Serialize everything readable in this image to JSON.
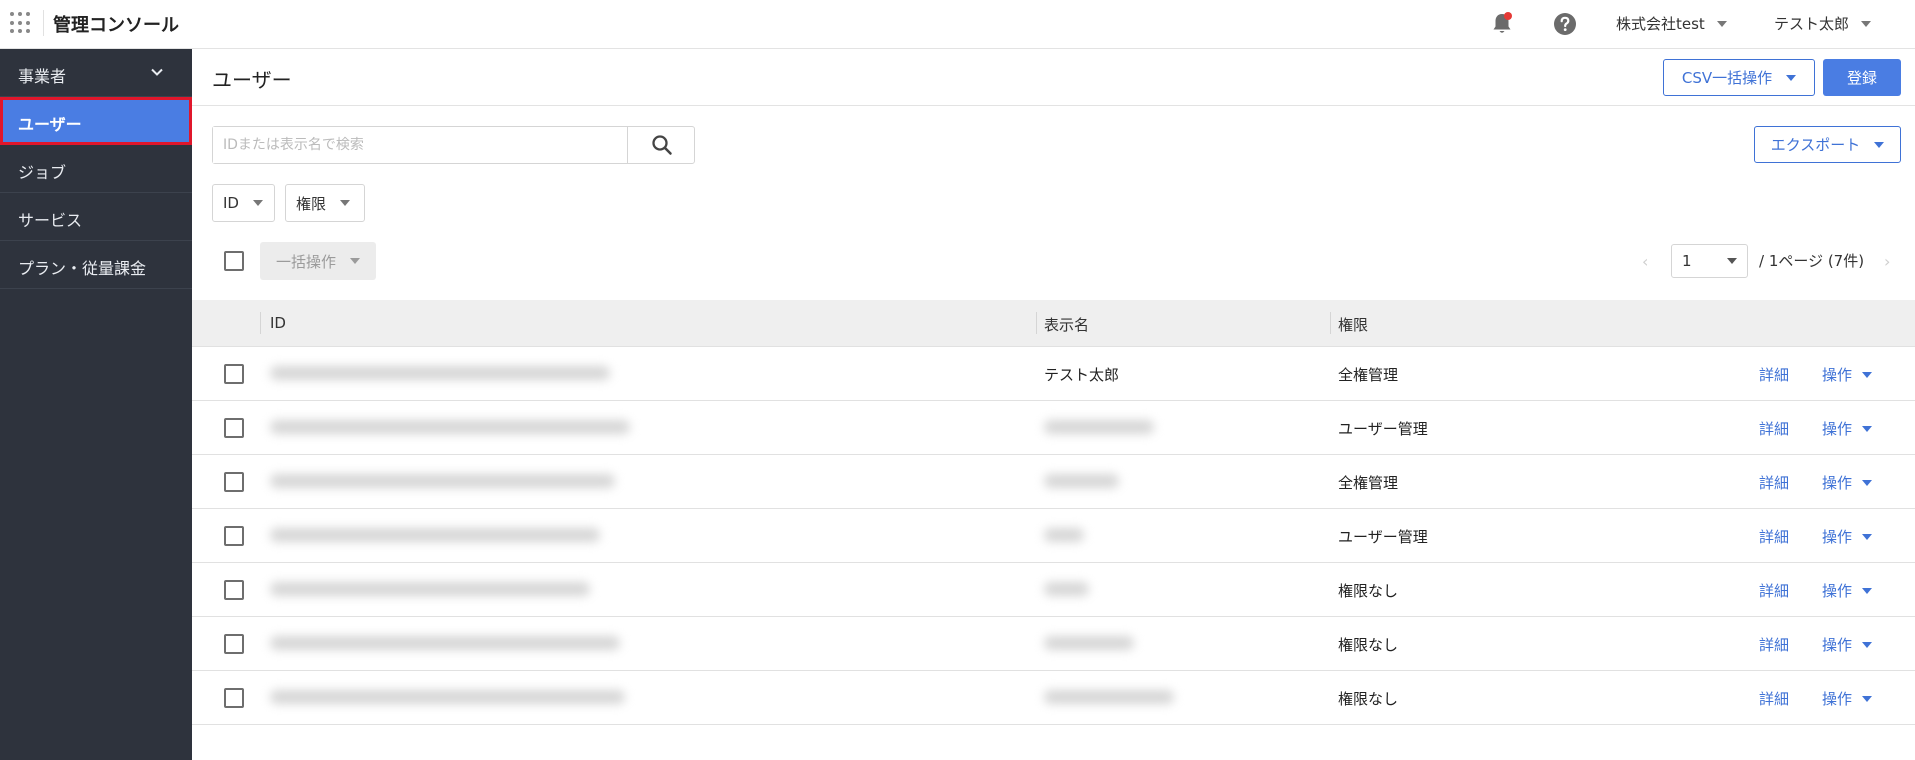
{
  "header": {
    "app_title": "管理コンソール",
    "company_menu": "株式会社test",
    "user_menu": "テスト太郎",
    "notification_badge_color": "#e53935",
    "icons": [
      "apps-grid-icon",
      "bell-icon",
      "help-icon"
    ]
  },
  "sidebar": {
    "section_label": "事業者",
    "items": [
      {
        "label": "ユーザー",
        "active": true
      },
      {
        "label": "ジョブ",
        "active": false
      },
      {
        "label": "サービス",
        "active": false
      },
      {
        "label": "プラン・従量課金",
        "active": false
      }
    ]
  },
  "main": {
    "page_title": "ユーザー",
    "csv_button": "CSV一括操作",
    "register_button": "登録",
    "export_button": "エクスポート",
    "search_placeholder": "IDまたは表示名で検索",
    "filters": [
      "ID",
      "権限"
    ],
    "bulk_action": "一括操作",
    "pagination": {
      "current_page": "1",
      "info": "/ 1ページ (7件)"
    },
    "table": {
      "columns": [
        "ID",
        "表示名",
        "権限"
      ],
      "rows": [
        {
          "display_name": "テスト太郎",
          "role": "全権管理",
          "detail": "詳細",
          "action": "操作"
        },
        {
          "display_name": "",
          "role": "ユーザー管理",
          "detail": "詳細",
          "action": "操作"
        },
        {
          "display_name": "",
          "role": "全権管理",
          "detail": "詳細",
          "action": "操作"
        },
        {
          "display_name": "",
          "role": "ユーザー管理",
          "detail": "詳細",
          "action": "操作"
        },
        {
          "display_name": "",
          "role": "権限なし",
          "detail": "詳細",
          "action": "操作"
        },
        {
          "display_name": "",
          "role": "権限なし",
          "detail": "詳細",
          "action": "操作"
        },
        {
          "display_name": "",
          "role": "権限なし",
          "detail": "詳細",
          "action": "操作"
        }
      ]
    }
  },
  "colors": {
    "accent": "#4a7de3",
    "link": "#3f72d6",
    "sidebar_bg": "#2e333d",
    "active_highlight_border": "#e0162b"
  }
}
